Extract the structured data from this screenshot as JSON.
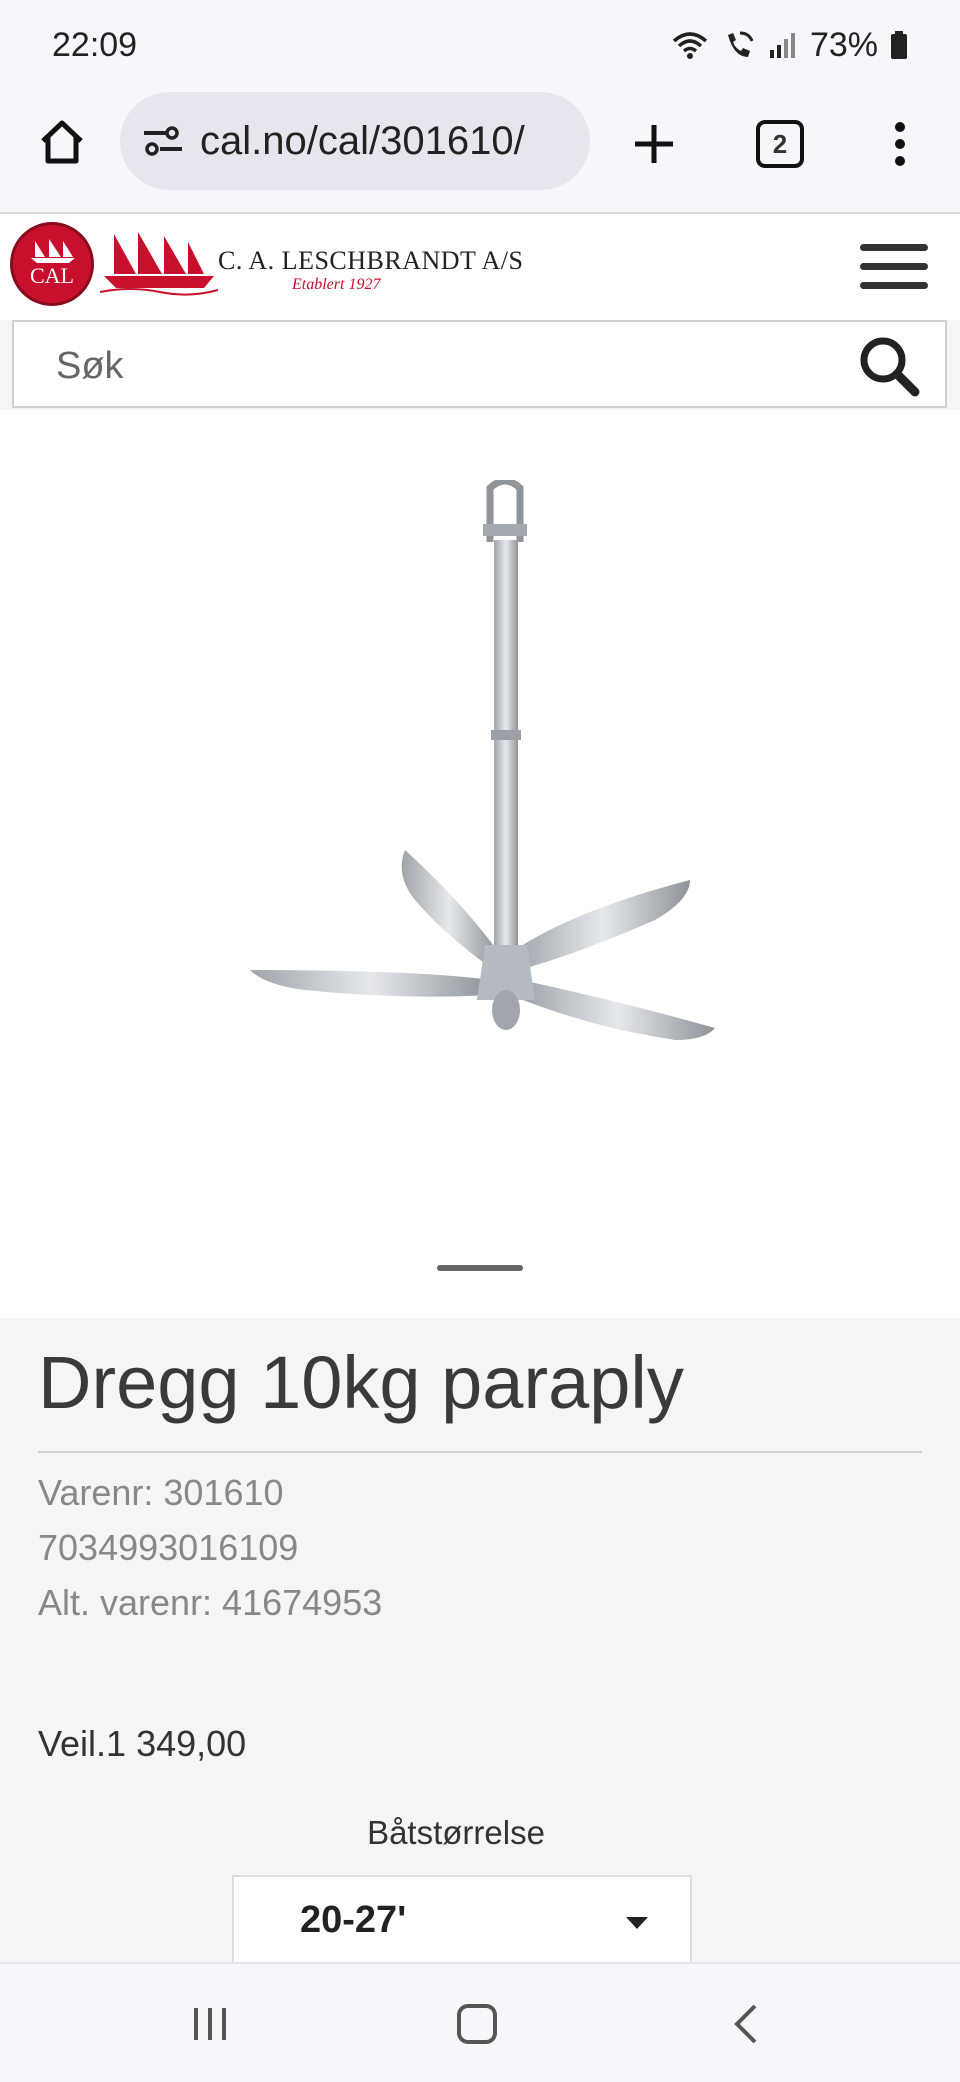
{
  "status_bar": {
    "time": "22:09",
    "battery": "73%",
    "icons": [
      "wifi-icon",
      "wifi-calling-icon",
      "signal-icon",
      "battery-icon"
    ]
  },
  "browser": {
    "url": "cal.no/cal/301610/",
    "tab_count": "2",
    "icons": [
      "home-icon",
      "site-settings-icon",
      "new-tab-icon",
      "tabs-icon",
      "more-vert-icon"
    ]
  },
  "site_header": {
    "logo_text": "CAL",
    "brand_name": "C. A. LESCHBRANDT A/S",
    "brand_tagline": "Etablert 1927",
    "menu_icon": "hamburger-menu-icon"
  },
  "search": {
    "placeholder": "Søk",
    "icon": "search-icon"
  },
  "gallery": {
    "image": "anchor-product-image",
    "slide_count": 1,
    "active_slide": 1
  },
  "product": {
    "title": "Dregg 10kg paraply",
    "sku": "Varenr: 301610",
    "ean": "7034993016109",
    "alt_sku": "Alt. varenr: 41674953",
    "price_label": "Veil.",
    "price_value": "1 349,00",
    "option_label": "Båtstørrelse",
    "option_selected": "20-27'"
  },
  "nav_bar": {
    "icons": [
      "recent-apps-icon",
      "home-button-icon",
      "back-icon"
    ]
  },
  "colors": {
    "brand_red": "#c8102e",
    "page_bg": "#f5f5f5",
    "chrome_bg": "#f7f7fb"
  }
}
